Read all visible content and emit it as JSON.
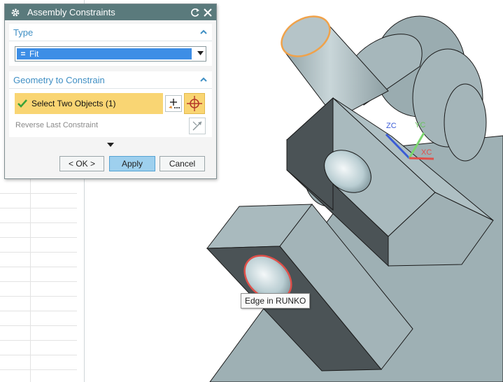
{
  "dialog": {
    "title": "Assembly Constraints",
    "type_section_label": "Type",
    "type_value": "Fit",
    "type_symbol": "=",
    "geometry_section_label": "Geometry to Constrain",
    "select_objects_label": "Select Two Objects (1)",
    "reverse_label": "Reverse Last Constraint",
    "buttons": {
      "ok": "< OK >",
      "apply": "Apply",
      "cancel": "Cancel"
    }
  },
  "viewport": {
    "tooltip": "Edge in RUNKO",
    "axes": {
      "z": "ZC",
      "y": "YC",
      "x": "XC"
    }
  },
  "colors": {
    "titlebar": "#5a7a7c",
    "section_header_text": "#3f8fc4",
    "selection_highlight": "#f9d573",
    "select_blue": "#3d8ee6",
    "apply_button": "#9ed0ee",
    "model_light": "#a7b8bc",
    "model_dark": "#4a5255",
    "edge_highlight_orange": "#f0a24a",
    "edge_highlight_red": "#e0504a"
  },
  "icons": {
    "gear": "gear-icon",
    "reset": "reset-icon",
    "close": "close-icon",
    "collapse": "chevron-up-icon",
    "dropdown": "caret-down-icon",
    "check": "check-icon",
    "add": "add-object-icon",
    "target": "crosshair-icon",
    "reverse": "reverse-icon",
    "more": "more-options-icon"
  }
}
